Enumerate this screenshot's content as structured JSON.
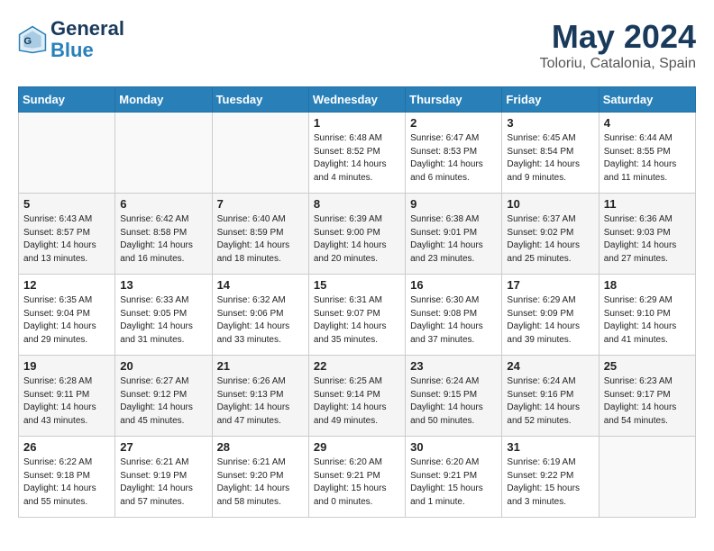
{
  "header": {
    "logo_line1": "General",
    "logo_line2": "Blue",
    "month_year": "May 2024",
    "location": "Toloriu, Catalonia, Spain"
  },
  "days_of_week": [
    "Sunday",
    "Monday",
    "Tuesday",
    "Wednesday",
    "Thursday",
    "Friday",
    "Saturday"
  ],
  "weeks": [
    [
      {
        "day": "",
        "info": ""
      },
      {
        "day": "",
        "info": ""
      },
      {
        "day": "",
        "info": ""
      },
      {
        "day": "1",
        "info": "Sunrise: 6:48 AM\nSunset: 8:52 PM\nDaylight: 14 hours\nand 4 minutes."
      },
      {
        "day": "2",
        "info": "Sunrise: 6:47 AM\nSunset: 8:53 PM\nDaylight: 14 hours\nand 6 minutes."
      },
      {
        "day": "3",
        "info": "Sunrise: 6:45 AM\nSunset: 8:54 PM\nDaylight: 14 hours\nand 9 minutes."
      },
      {
        "day": "4",
        "info": "Sunrise: 6:44 AM\nSunset: 8:55 PM\nDaylight: 14 hours\nand 11 minutes."
      }
    ],
    [
      {
        "day": "5",
        "info": "Sunrise: 6:43 AM\nSunset: 8:57 PM\nDaylight: 14 hours\nand 13 minutes."
      },
      {
        "day": "6",
        "info": "Sunrise: 6:42 AM\nSunset: 8:58 PM\nDaylight: 14 hours\nand 16 minutes."
      },
      {
        "day": "7",
        "info": "Sunrise: 6:40 AM\nSunset: 8:59 PM\nDaylight: 14 hours\nand 18 minutes."
      },
      {
        "day": "8",
        "info": "Sunrise: 6:39 AM\nSunset: 9:00 PM\nDaylight: 14 hours\nand 20 minutes."
      },
      {
        "day": "9",
        "info": "Sunrise: 6:38 AM\nSunset: 9:01 PM\nDaylight: 14 hours\nand 23 minutes."
      },
      {
        "day": "10",
        "info": "Sunrise: 6:37 AM\nSunset: 9:02 PM\nDaylight: 14 hours\nand 25 minutes."
      },
      {
        "day": "11",
        "info": "Sunrise: 6:36 AM\nSunset: 9:03 PM\nDaylight: 14 hours\nand 27 minutes."
      }
    ],
    [
      {
        "day": "12",
        "info": "Sunrise: 6:35 AM\nSunset: 9:04 PM\nDaylight: 14 hours\nand 29 minutes."
      },
      {
        "day": "13",
        "info": "Sunrise: 6:33 AM\nSunset: 9:05 PM\nDaylight: 14 hours\nand 31 minutes."
      },
      {
        "day": "14",
        "info": "Sunrise: 6:32 AM\nSunset: 9:06 PM\nDaylight: 14 hours\nand 33 minutes."
      },
      {
        "day": "15",
        "info": "Sunrise: 6:31 AM\nSunset: 9:07 PM\nDaylight: 14 hours\nand 35 minutes."
      },
      {
        "day": "16",
        "info": "Sunrise: 6:30 AM\nSunset: 9:08 PM\nDaylight: 14 hours\nand 37 minutes."
      },
      {
        "day": "17",
        "info": "Sunrise: 6:29 AM\nSunset: 9:09 PM\nDaylight: 14 hours\nand 39 minutes."
      },
      {
        "day": "18",
        "info": "Sunrise: 6:29 AM\nSunset: 9:10 PM\nDaylight: 14 hours\nand 41 minutes."
      }
    ],
    [
      {
        "day": "19",
        "info": "Sunrise: 6:28 AM\nSunset: 9:11 PM\nDaylight: 14 hours\nand 43 minutes."
      },
      {
        "day": "20",
        "info": "Sunrise: 6:27 AM\nSunset: 9:12 PM\nDaylight: 14 hours\nand 45 minutes."
      },
      {
        "day": "21",
        "info": "Sunrise: 6:26 AM\nSunset: 9:13 PM\nDaylight: 14 hours\nand 47 minutes."
      },
      {
        "day": "22",
        "info": "Sunrise: 6:25 AM\nSunset: 9:14 PM\nDaylight: 14 hours\nand 49 minutes."
      },
      {
        "day": "23",
        "info": "Sunrise: 6:24 AM\nSunset: 9:15 PM\nDaylight: 14 hours\nand 50 minutes."
      },
      {
        "day": "24",
        "info": "Sunrise: 6:24 AM\nSunset: 9:16 PM\nDaylight: 14 hours\nand 52 minutes."
      },
      {
        "day": "25",
        "info": "Sunrise: 6:23 AM\nSunset: 9:17 PM\nDaylight: 14 hours\nand 54 minutes."
      }
    ],
    [
      {
        "day": "26",
        "info": "Sunrise: 6:22 AM\nSunset: 9:18 PM\nDaylight: 14 hours\nand 55 minutes."
      },
      {
        "day": "27",
        "info": "Sunrise: 6:21 AM\nSunset: 9:19 PM\nDaylight: 14 hours\nand 57 minutes."
      },
      {
        "day": "28",
        "info": "Sunrise: 6:21 AM\nSunset: 9:20 PM\nDaylight: 14 hours\nand 58 minutes."
      },
      {
        "day": "29",
        "info": "Sunrise: 6:20 AM\nSunset: 9:21 PM\nDaylight: 15 hours\nand 0 minutes."
      },
      {
        "day": "30",
        "info": "Sunrise: 6:20 AM\nSunset: 9:21 PM\nDaylight: 15 hours\nand 1 minute."
      },
      {
        "day": "31",
        "info": "Sunrise: 6:19 AM\nSunset: 9:22 PM\nDaylight: 15 hours\nand 3 minutes."
      },
      {
        "day": "",
        "info": ""
      }
    ]
  ]
}
